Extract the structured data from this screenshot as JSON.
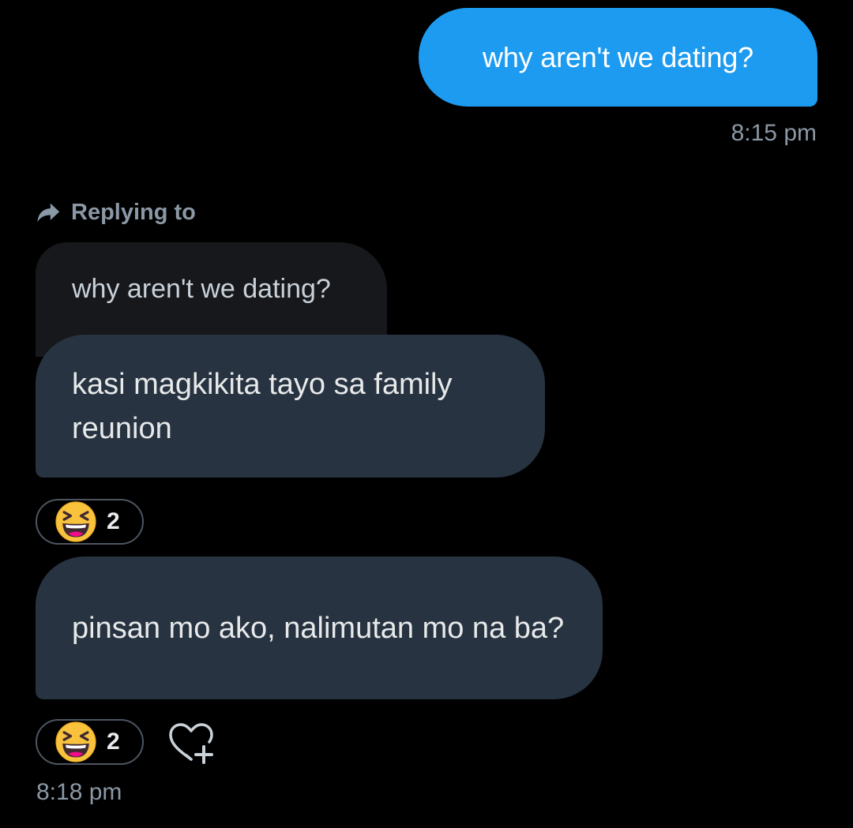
{
  "sent_message": {
    "text": "why aren't we dating?",
    "time": "8:15 pm",
    "color": "#1d9bf0"
  },
  "reply": {
    "icon": "reply-arrow-icon",
    "label": "Replying to",
    "quoted_text": "why aren't we dating?"
  },
  "received_messages": [
    {
      "text": "kasi magkikita tayo sa family reunion",
      "reaction": {
        "emoji": "laughing-squinting-face-icon",
        "count": "2"
      }
    },
    {
      "text": "pinsan mo ako, nalimutan mo na ba?",
      "reaction": {
        "emoji": "laughing-squinting-face-icon",
        "count": "2"
      }
    }
  ],
  "add_reaction_icon": "heart-plus-icon",
  "received_time": "8:18 pm",
  "colors": {
    "background": "#000000",
    "received_bubble": "#273340",
    "quoted_bubble": "#16181c",
    "secondary_text": "#8b98a5"
  }
}
